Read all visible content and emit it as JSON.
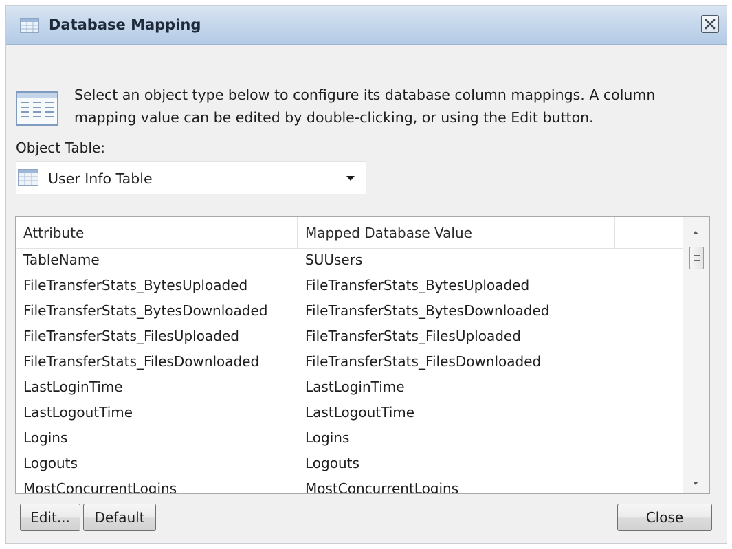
{
  "window": {
    "title": "Database Mapping",
    "title_icon": "table-icon",
    "close_icon": "close-icon"
  },
  "info": {
    "icon": "table-icon",
    "line1": "Select an object type below to configure its database column mappings. A column",
    "line2": "mapping value can be edited by double-clicking, or using the Edit button."
  },
  "object_table": {
    "label": "Object Table:",
    "icon": "table-icon",
    "selected": "User Info Table"
  },
  "grid": {
    "columns": [
      "Attribute",
      "Mapped Database Value"
    ],
    "rows": [
      {
        "attribute": "TableName",
        "value": "SUUsers"
      },
      {
        "attribute": "FileTransferStats_BytesUploaded",
        "value": "FileTransferStats_BytesUploaded"
      },
      {
        "attribute": "FileTransferStats_BytesDownloaded",
        "value": "FileTransferStats_BytesDownloaded"
      },
      {
        "attribute": "FileTransferStats_FilesUploaded",
        "value": "FileTransferStats_FilesUploaded"
      },
      {
        "attribute": "FileTransferStats_FilesDownloaded",
        "value": "FileTransferStats_FilesDownloaded"
      },
      {
        "attribute": "LastLoginTime",
        "value": "LastLoginTime"
      },
      {
        "attribute": "LastLogoutTime",
        "value": "LastLogoutTime"
      },
      {
        "attribute": "Logins",
        "value": "Logins"
      },
      {
        "attribute": "Logouts",
        "value": "Logouts"
      },
      {
        "attribute": "MostConcurrentLogins",
        "value": "MostConcurrentLogins"
      }
    ]
  },
  "buttons": {
    "edit": "Edit...",
    "default": "Default",
    "close": "Close"
  }
}
